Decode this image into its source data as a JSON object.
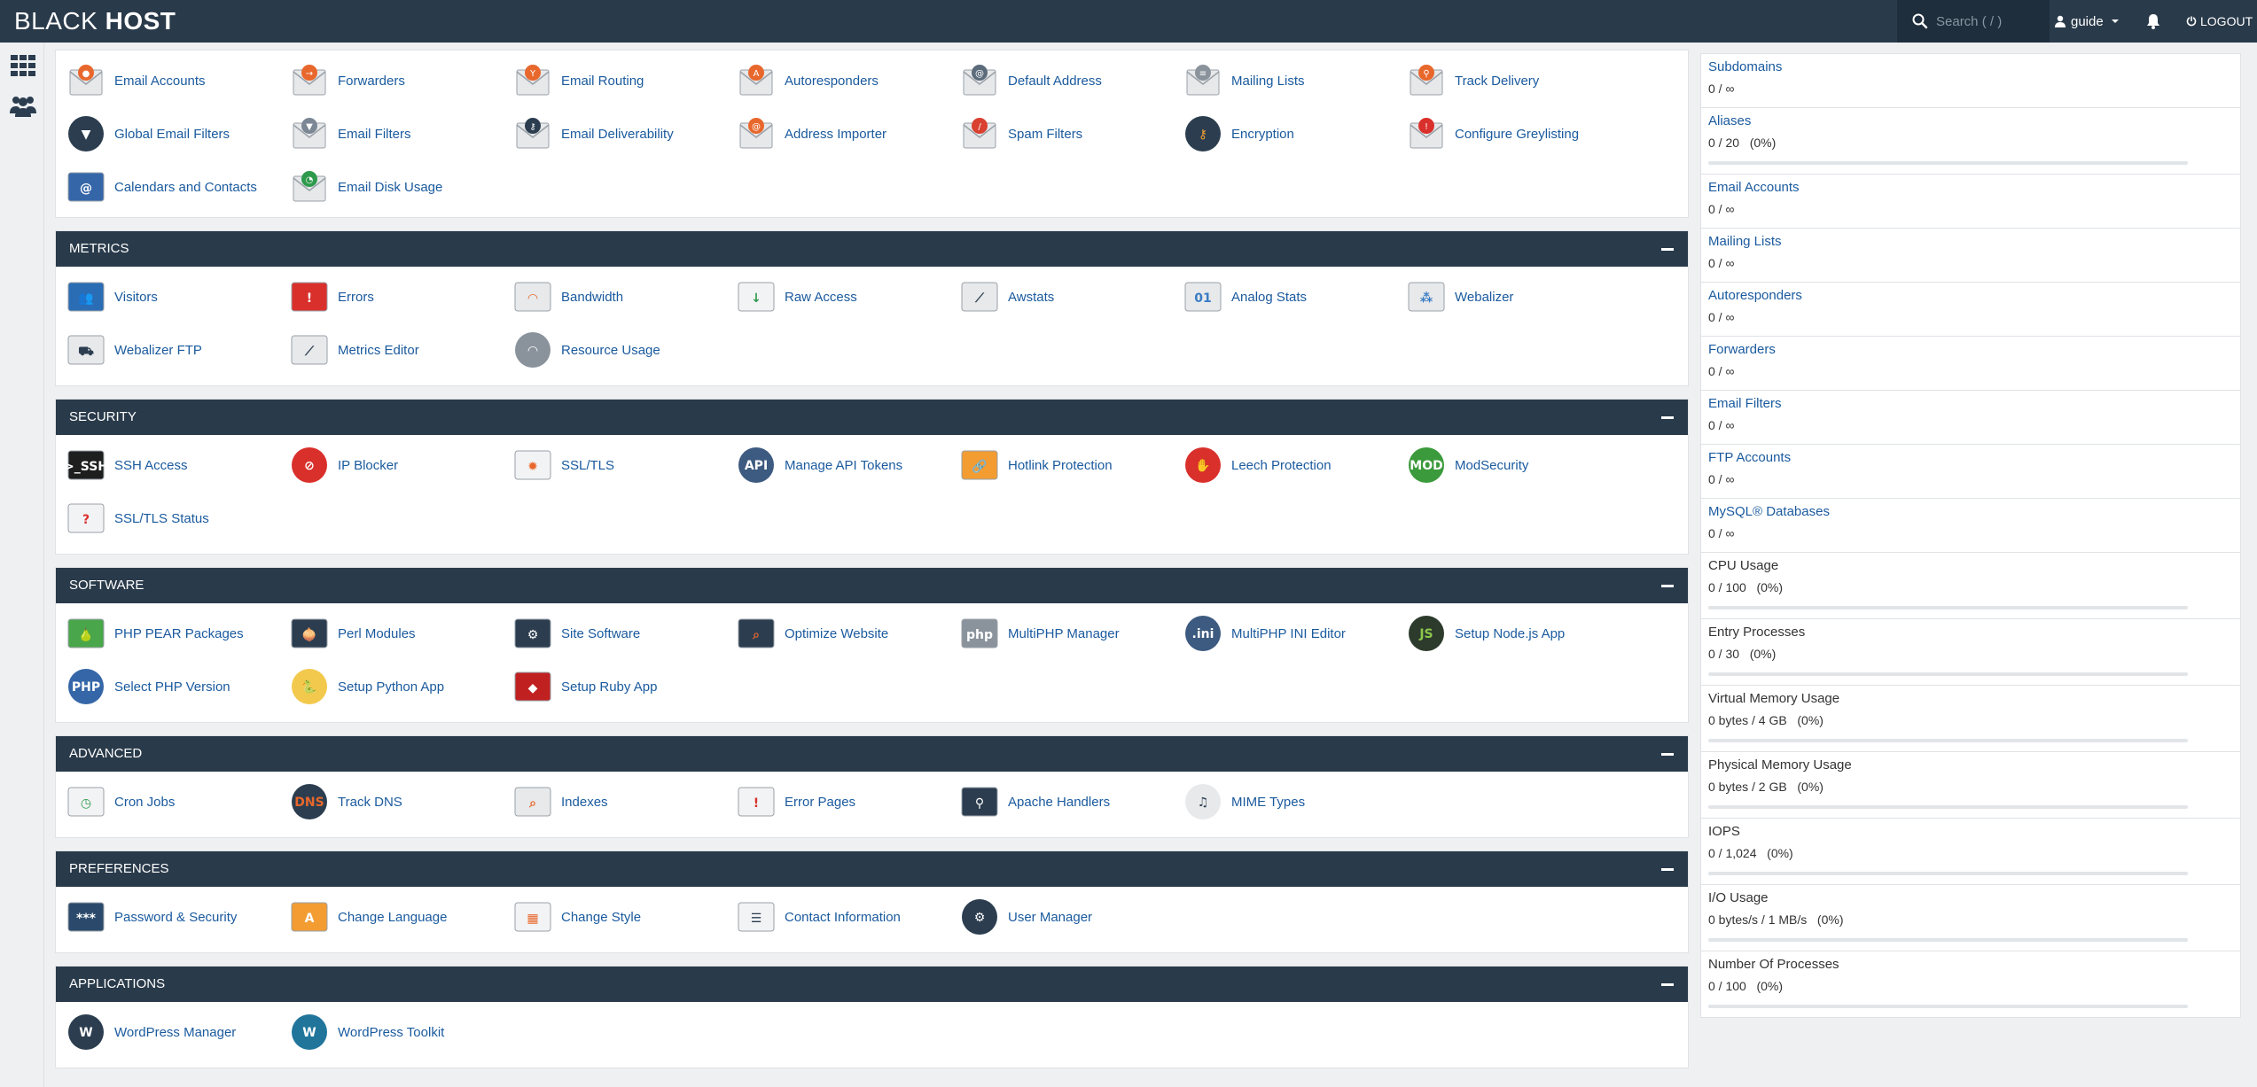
{
  "header": {
    "logo_part1": "BLACK",
    "logo_part2": "HOST",
    "search_placeholder": "Search ( / )",
    "user": "guide",
    "logout": "LOGOUT"
  },
  "sections": {
    "email": {
      "items": [
        "Email Accounts",
        "Forwarders",
        "Email Routing",
        "Autoresponders",
        "Default Address",
        "Mailing Lists",
        "Track Delivery",
        "Global Email Filters",
        "Email Filters",
        "Email Deliverability",
        "Address Importer",
        "Spam Filters",
        "Encryption",
        "Configure Greylisting",
        "Calendars and Contacts",
        "Email Disk Usage"
      ]
    },
    "metrics": {
      "title": "METRICS",
      "items": [
        "Visitors",
        "Errors",
        "Bandwidth",
        "Raw Access",
        "Awstats",
        "Analog Stats",
        "Webalizer",
        "Webalizer FTP",
        "Metrics Editor",
        "Resource Usage"
      ]
    },
    "security": {
      "title": "SECURITY",
      "items": [
        "SSH Access",
        "IP Blocker",
        "SSL/TLS",
        "Manage API Tokens",
        "Hotlink Protection",
        "Leech Protection",
        "ModSecurity",
        "SSL/TLS Status"
      ]
    },
    "software": {
      "title": "SOFTWARE",
      "items": [
        "PHP PEAR Packages",
        "Perl Modules",
        "Site Software",
        "Optimize Website",
        "MultiPHP Manager",
        "MultiPHP INI Editor",
        "Setup Node.js App",
        "Select PHP Version",
        "Setup Python App",
        "Setup Ruby App"
      ]
    },
    "advanced": {
      "title": "ADVANCED",
      "items": [
        "Cron Jobs",
        "Track DNS",
        "Indexes",
        "Error Pages",
        "Apache Handlers",
        "MIME Types"
      ]
    },
    "preferences": {
      "title": "PREFERENCES",
      "items": [
        "Password & Security",
        "Change Language",
        "Change Style",
        "Contact Information",
        "User Manager"
      ]
    },
    "applications": {
      "title": "APPLICATIONS",
      "items": [
        "WordPress Manager",
        "WordPress Toolkit"
      ]
    }
  },
  "stats": [
    {
      "name": "Subdomains",
      "value": "0 / ∞"
    },
    {
      "name": "Aliases",
      "value": "0 / 20   (0%)",
      "percent": 0
    },
    {
      "name": "Email Accounts",
      "value": "0 / ∞"
    },
    {
      "name": "Mailing Lists",
      "value": "0 / ∞"
    },
    {
      "name": "Autoresponders",
      "value": "0 / ∞"
    },
    {
      "name": "Forwarders",
      "value": "0 / ∞"
    },
    {
      "name": "Email Filters",
      "value": "0 / ∞"
    },
    {
      "name": "FTP Accounts",
      "value": "0 / ∞"
    },
    {
      "name": "MySQL® Databases",
      "value": "0 / ∞"
    },
    {
      "name": "CPU Usage",
      "value": "0 / 100   (0%)",
      "percent": 0
    },
    {
      "name": "Entry Processes",
      "value": "0 / 30   (0%)",
      "percent": 0
    },
    {
      "name": "Virtual Memory Usage",
      "value": "0 bytes / 4 GB   (0%)",
      "percent": 0
    },
    {
      "name": "Physical Memory Usage",
      "value": "0 bytes / 2 GB   (0%)",
      "percent": 0
    },
    {
      "name": "IOPS",
      "value": "0 / 1,024   (0%)",
      "percent": 0
    },
    {
      "name": "I/O Usage",
      "value": "0 bytes/s / 1 MB/s   (0%)",
      "percent": 0
    },
    {
      "name": "Number Of Processes",
      "value": "0 / 100   (0%)",
      "percent": 0
    }
  ],
  "colors": {
    "accent": "#1a5a9e",
    "header_bg": "#293a4a",
    "bar_fill": "#4a90d9"
  }
}
